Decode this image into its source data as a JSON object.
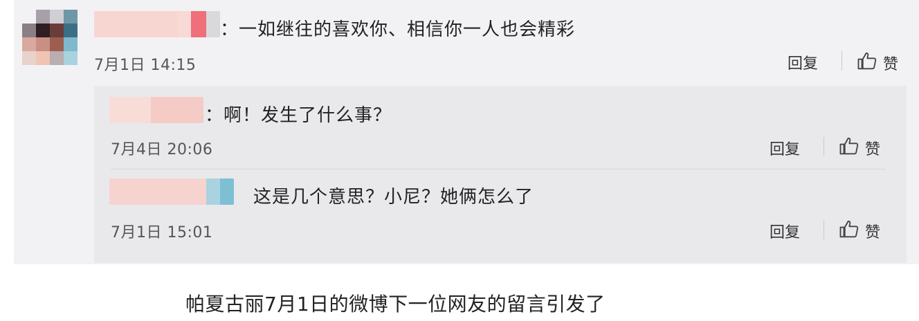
{
  "comment": {
    "text": "：一如继往的喜欢你、相信你一人也会精彩",
    "time": "7月1日 14:15",
    "reply_label": "回复",
    "like_label": "赞"
  },
  "replies": [
    {
      "text": "：啊！发生了什么事？",
      "time": "7月4日 20:06",
      "reply_label": "回复",
      "like_label": "赞"
    },
    {
      "text": "这是几个意思？小尼？她俩怎么了",
      "time": "7月1日 15:01",
      "reply_label": "回复",
      "like_label": "赞"
    }
  ],
  "caption": "帕夏古丽7月1日的微博下一位网友的留言引发了",
  "colors": {
    "avatar": [
      "#f2f2f4",
      "#a7a0a8",
      "#cfcfd4",
      "#6f97a7",
      "#8a7f86",
      "#2f1e24",
      "#6a3d3a",
      "#3b6f86",
      "#d9a89e",
      "#c88f82",
      "#9b5e4f",
      "#7fb9cb",
      "#e8d2cc",
      "#f1c3b3",
      "#b9aeb0",
      "#a8d2de"
    ],
    "name_blur": "#f4c8c4"
  },
  "icons": [
    "thumb-up-icon"
  ]
}
